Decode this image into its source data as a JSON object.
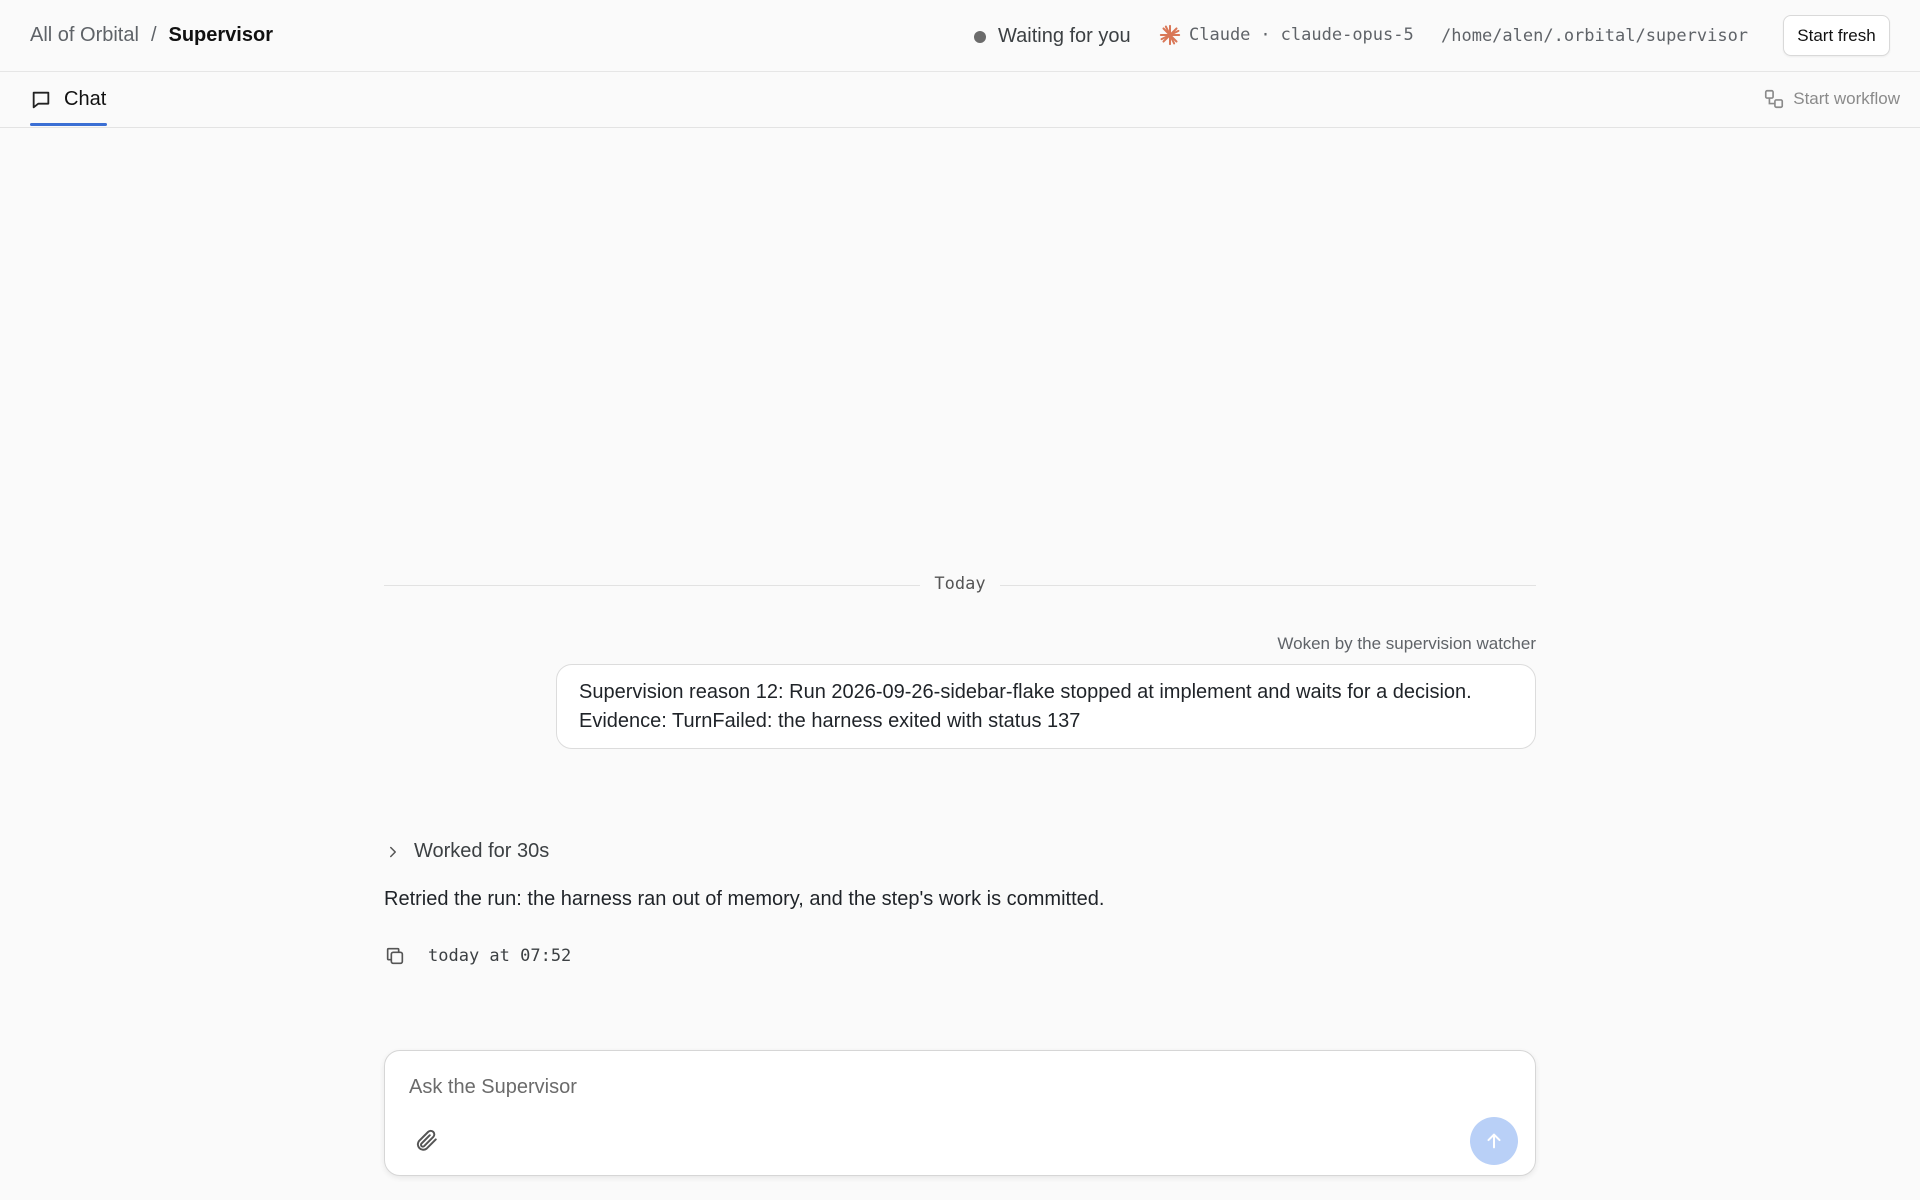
{
  "breadcrumb": {
    "root": "All of Orbital",
    "separator": "/",
    "current": "Supervisor"
  },
  "status": {
    "label": "Waiting for you"
  },
  "agent": {
    "name": "Claude",
    "separator": "·",
    "model": "claude-opus-5"
  },
  "workspace_path": "/home/alen/.orbital/supervisor",
  "header_actions": {
    "start_fresh": "Start fresh"
  },
  "tabs": [
    {
      "label": "Chat",
      "active": true
    }
  ],
  "tab_actions": {
    "start_workflow": "Start workflow"
  },
  "conversation": {
    "date_divider": "Today",
    "user_message": {
      "source_note": "Woken by the supervision watcher",
      "line1": "Supervision reason 12: Run 2026-09-26-sidebar-flake stopped at implement and waits for a decision.",
      "line2": "Evidence: TurnFailed: the harness exited with status 137"
    },
    "assistant_message": {
      "worked_label": "Worked for 30s",
      "text": "Retried the run: the harness ran out of memory, and the step's work is committed.",
      "timestamp": "today at 07:52"
    }
  },
  "composer": {
    "placeholder": "Ask the Supervisor"
  },
  "icons": {
    "status_dot": "status-dot",
    "agent": "claude-sparkle-icon",
    "tab_chat": "chat-bubble-icon",
    "start_workflow": "workflow-icon",
    "expand": "chevron-right-icon",
    "copy": "copy-icon",
    "attach": "paperclip-icon",
    "send": "arrow-up-icon"
  },
  "colors": {
    "accent": "#3b6fd4",
    "claude_brand": "#d97757",
    "send_button": "#b9d0f7",
    "status_dot": "#6b6b6b"
  }
}
